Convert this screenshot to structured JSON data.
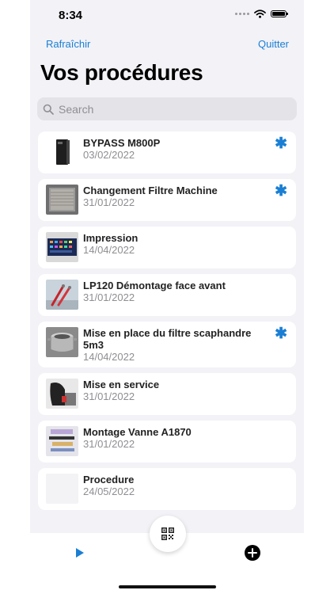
{
  "status_bar": {
    "time": "8:34"
  },
  "header": {
    "refresh_label": "Rafraîchir",
    "quit_label": "Quitter",
    "title": "Vos procédures"
  },
  "search": {
    "placeholder": "Search"
  },
  "procedures": [
    {
      "title": "BYPASS M800P",
      "date": "03/02/2022",
      "starred": true,
      "thumbnail": "device-icon"
    },
    {
      "title": "Changement Filtre Machine",
      "date": "31/01/2022",
      "starred": true,
      "thumbnail": "filter-icon"
    },
    {
      "title": "Impression",
      "date": "14/04/2022",
      "starred": false,
      "thumbnail": "screen-icon"
    },
    {
      "title": "LP120 Démontage face avant",
      "date": "31/01/2022",
      "starred": false,
      "thumbnail": "tools-icon"
    },
    {
      "title": "Mise en place du filtre scaphandre 5m3",
      "date": "14/04/2022",
      "starred": true,
      "thumbnail": "pot-icon"
    },
    {
      "title": "Mise en service",
      "date": "31/01/2022",
      "starred": false,
      "thumbnail": "machine-icon"
    },
    {
      "title": "Montage Vanne A1870",
      "date": "31/01/2022",
      "starred": false,
      "thumbnail": "parts-icon"
    },
    {
      "title": "Procedure",
      "date": "24/05/2022",
      "starred": false,
      "thumbnail": "blank"
    }
  ],
  "star_glyph": "✱",
  "tab_bar": {
    "left_icon": "play-icon",
    "center_icon": "qr-code-icon",
    "right_icon": "add-icon"
  },
  "colors": {
    "accent": "#1a7fd4",
    "background": "#f2f2f7",
    "card": "#ffffff"
  }
}
